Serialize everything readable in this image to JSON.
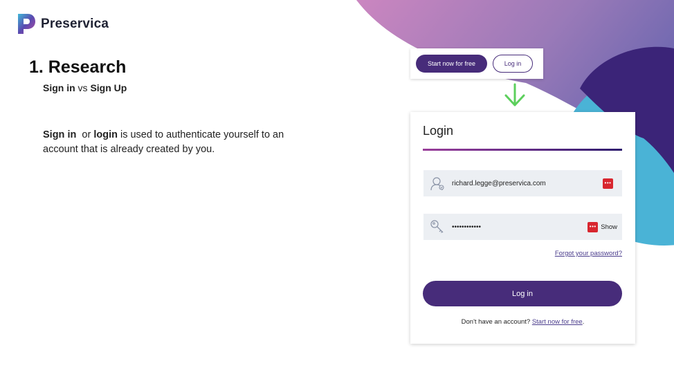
{
  "brand": {
    "name": "Preservica",
    "logo_icon": "preservica-logo-icon",
    "colors": {
      "primary": "#472c7a",
      "magenta": "#c383bf",
      "blue": "#4ab3d6",
      "navy": "#3b2478"
    }
  },
  "slide": {
    "heading": "1. Research",
    "subheading": {
      "term1": "Sign in",
      "separator": " vs ",
      "term2": "Sign Up"
    },
    "body": {
      "term1": "Sign in",
      "joiner": "  or ",
      "term2": "login",
      "rest": " is used to authenticate yourself to an account that is already created by you."
    }
  },
  "top_nav": {
    "start_label": "Start now for free",
    "login_label": "Log in"
  },
  "arrow": {
    "icon": "arrow-down-icon",
    "color": "#5ccf5c"
  },
  "login_form": {
    "title": "Login",
    "email": {
      "icon": "user-icon",
      "value": "richard.legge@preservica.com",
      "pm_icon": "password-manager-icon"
    },
    "password": {
      "icon": "key-icon",
      "value": "••••••••••••",
      "pm_icon": "password-manager-icon",
      "show_label": "Show"
    },
    "forgot_label": "Forgot your password?",
    "submit_label": "Log in",
    "signup_prompt": "Don't have an account? ",
    "signup_link": "Start now for free",
    "signup_suffix": "."
  }
}
